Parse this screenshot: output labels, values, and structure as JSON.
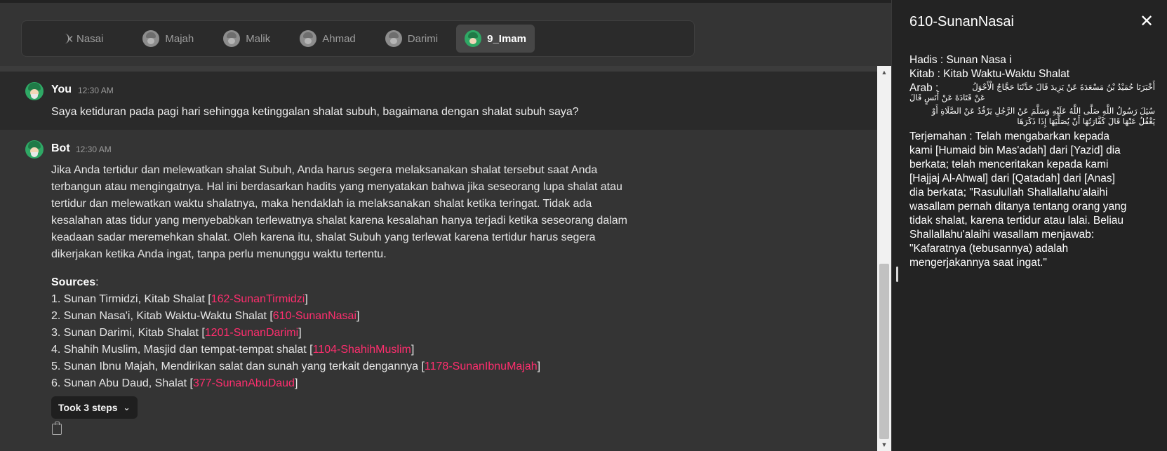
{
  "tabs": [
    {
      "label": "Nasai",
      "active": false,
      "partial": true
    },
    {
      "label": "Majah",
      "active": false
    },
    {
      "label": "Malik",
      "active": false
    },
    {
      "label": "Ahmad",
      "active": false
    },
    {
      "label": "Darimi",
      "active": false
    },
    {
      "label": "9_Imam",
      "active": true
    }
  ],
  "user_message": {
    "name": "You",
    "time": "12:30 AM",
    "text": "Saya ketiduran pada pagi hari sehingga ketinggalan shalat subuh, bagaimana dengan shalat subuh saya?"
  },
  "bot_message": {
    "name": "Bot",
    "time": "12:30 AM",
    "lines": [
      "Jika Anda tertidur dan melewatkan shalat Subuh, Anda harus segera melaksanakan shalat tersebut saat Anda",
      "terbangun atau mengingatnya. Hal ini berdasarkan hadits yang menyatakan bahwa jika seseorang lupa shalat atau",
      "tertidur dan melewatkan waktu shalatnya, maka hendaklah ia melaksanakan shalat ketika teringat. Tidak ada",
      "kesalahan atas tidur yang menyebabkan terlewatnya shalat karena kesalahan hanya terjadi ketika seseorang dalam",
      "keadaan sadar meremehkan shalat. Oleh karena itu, shalat Subuh yang terlewat karena tertidur harus segera",
      "dikerjakan ketika Anda ingat, tanpa perlu menunggu waktu tertentu."
    ],
    "sources_title": "Sources",
    "sources": [
      {
        "prefix": "1. Sunan Tirmidzi, Kitab Shalat [",
        "link": "162-SunanTirmidzi",
        "suffix": "]"
      },
      {
        "prefix": "2. Sunan Nasa'i, Kitab Waktu-Waktu Shalat [",
        "link": "610-SunanNasai",
        "suffix": "]"
      },
      {
        "prefix": "3. Sunan Darimi, Kitab Shalat [",
        "link": "1201-SunanDarimi",
        "suffix": "]"
      },
      {
        "prefix": "4. Shahih Muslim, Masjid dan tempat-tempat shalat [",
        "link": "1104-ShahihMuslim",
        "suffix": "]"
      },
      {
        "prefix": "5. Sunan Ibnu Majah, Mendirikan salat dan sunah yang terkait dengannya [",
        "link": "1178-SunanIbnuMajah",
        "suffix": "]"
      },
      {
        "prefix": "6. Sunan Abu Daud, Shalat [",
        "link": "377-SunanAbuDaud",
        "suffix": "]"
      }
    ],
    "steps_label": "Took 3 steps"
  },
  "panel": {
    "title": "610-SunanNasai",
    "hadis": "Hadis : Sunan Nasa i",
    "kitab": "Kitab : Kitab Waktu-Waktu Shalat",
    "arab_label": "Arab :",
    "arab_lines": [
      "أَخْبَرَنَا حُمَيْدُ بْنُ مَسْعَدَةَ عَنْ يَزِيدَ قَالَ حَدَّثَنَا حَجَّاجٌ الْأَحْوَلُ",
      "عَنْ قَتَادَةَ عَنْ أَنَسٍ قَالَ",
      "سُئِلَ رَسُولُ اللَّهِ صَلَّى اللَّهُ عَلَيْهِ وَسَلَّمَ عَنْ الرَّجُلِ يَرْقُدُ عَنْ الصَّلَاةِ أَوْ",
      "يَغْفُلُ عَنْهَا قَالَ كَفَّارَتُهَا أَنْ يُصَلِّيَهَا إِذَا ذَكَرَهَا"
    ],
    "terjemahan_lines": [
      "Terjemahan : Telah mengabarkan kepada",
      "kami [Humaid bin Mas'adah] dari [Yazid] dia",
      "berkata; telah menceritakan kepada kami",
      "[Hajjaj Al-Ahwal] dari [Qatadah] dari [Anas]",
      "dia berkata; \"Rasulullah Shallallahu'alaihi",
      "wasallam pernah ditanya tentang orang yang",
      "tidak shalat, karena tertidur atau lalai. Beliau",
      "Shallallahu'alaihi wasallam menjawab:",
      "\"Kafaratnya (tebusannya) adalah",
      "mengerjakannya saat ingat.\""
    ]
  },
  "icons": {
    "prev": "chevron-left-icon",
    "close": "close-icon",
    "copy": "copy-icon",
    "steps_chevron": "chevron-down-icon"
  },
  "colors": {
    "link": "#ff2e6e",
    "active_tab": "#474747",
    "avatar": "#2fa865"
  }
}
